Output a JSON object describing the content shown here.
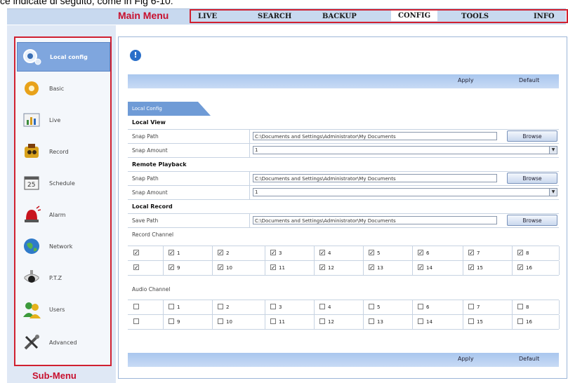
{
  "caption": "ce indicate di seguito, come in Fig 6-10:",
  "main_menu_label": "Main Menu",
  "sub_menu_label": "Sub-Menu",
  "top_menu": [
    "LIVE",
    "SEARCH",
    "BACKUP",
    "CONFIG",
    "TOOLS",
    "INFO"
  ],
  "active_top_menu": "CONFIG",
  "sidebar": {
    "items": [
      {
        "label": "Local config",
        "icon": "local-config-icon",
        "active": true
      },
      {
        "label": "Basic",
        "icon": "basic-gear-icon"
      },
      {
        "label": "Live",
        "icon": "live-chart-icon"
      },
      {
        "label": "Record",
        "icon": "record-icon"
      },
      {
        "label": "Schedule",
        "icon": "calendar-icon"
      },
      {
        "label": "Alarm",
        "icon": "alarm-siren-icon"
      },
      {
        "label": "Network",
        "icon": "globe-icon"
      },
      {
        "label": "P.T.Z",
        "icon": "ptz-camera-icon"
      },
      {
        "label": "Users",
        "icon": "users-icon"
      },
      {
        "label": "Advanced",
        "icon": "tools-icon"
      }
    ]
  },
  "actions": {
    "apply": "Apply",
    "default": "Default"
  },
  "tab_label": "Local Config",
  "local_view": {
    "title": "Local View",
    "snap_path_label": "Snap Path",
    "snap_path_value": "C:\\Documents and Settings\\Administrator\\My Documents",
    "snap_amount_label": "Snap Amount",
    "snap_amount_value": "1",
    "browse": "Browse"
  },
  "remote_playback": {
    "title": "Remote Playback",
    "snap_path_label": "Snap Path",
    "snap_path_value": "C:\\Documents and Settings\\Administrator\\My Documents",
    "snap_amount_label": "Snap Amount",
    "snap_amount_value": "1",
    "browse": "Browse"
  },
  "local_record": {
    "title": "Local Record",
    "save_path_label": "Save Path",
    "save_path_value": "C:\\Documents and Settings\\Administrator\\My Documents",
    "browse": "Browse"
  },
  "record_channel": {
    "label": "Record Channel",
    "rows": [
      {
        "all_checked": true,
        "channels": [
          1,
          2,
          3,
          4,
          5,
          6,
          7,
          8
        ],
        "checked": true
      },
      {
        "all_checked": true,
        "channels": [
          9,
          10,
          11,
          12,
          13,
          14,
          15,
          16
        ],
        "checked": true
      }
    ]
  },
  "audio_channel": {
    "label": "Audio Channel",
    "rows": [
      {
        "all_checked": false,
        "channels": [
          1,
          2,
          3,
          4,
          5,
          6,
          7,
          8
        ],
        "checked": false
      },
      {
        "all_checked": false,
        "channels": [
          9,
          10,
          11,
          12,
          13,
          14,
          15,
          16
        ],
        "checked": false
      }
    ]
  },
  "colors": {
    "accent": "#d02030",
    "menu_bg": "#c8d9ef",
    "sidebar_active": "#7fa6de"
  }
}
